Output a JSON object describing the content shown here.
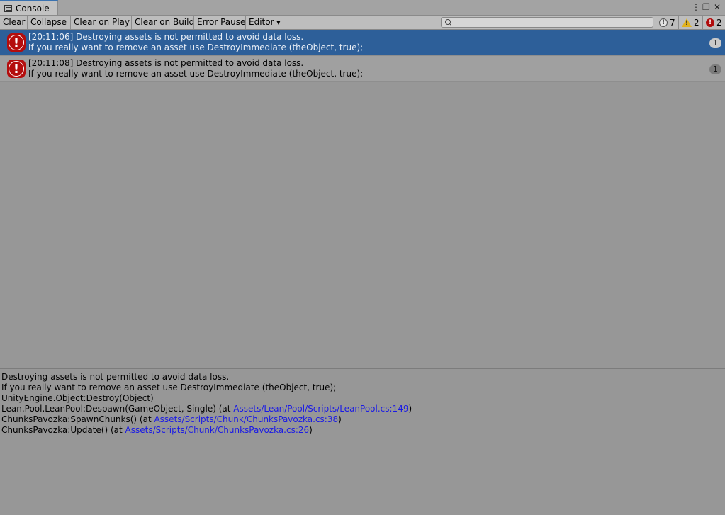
{
  "tab": {
    "title": "Console"
  },
  "window": {
    "menu_glyph": "⋮",
    "restore_glyph": "❐",
    "close_glyph": "✕"
  },
  "toolbar": {
    "clear": "Clear",
    "collapse": "Collapse",
    "clear_on_play": "Clear on Play",
    "clear_on_build": "Clear on Build",
    "error_pause": "Error Pause",
    "editor": "Editor",
    "editor_caret": "▾",
    "search_placeholder": ""
  },
  "counters": {
    "info": "7",
    "warnings": "2",
    "errors": "2"
  },
  "entries": [
    {
      "line1": "[20:11:06] Destroying assets is not permitted to avoid data loss.",
      "line2": "If you really want to remove an asset use DestroyImmediate (theObject, true);",
      "count": "1",
      "selected": true
    },
    {
      "line1": "[20:11:08] Destroying assets is not permitted to avoid data loss.",
      "line2": "If you really want to remove an asset use DestroyImmediate (theObject, true);",
      "count": "1",
      "selected": false
    }
  ],
  "detail": {
    "line1": "Destroying assets is not permitted to avoid data loss.",
    "line2": "If you really want to remove an asset use DestroyImmediate (theObject, true);",
    "line3": "UnityEngine.Object:Destroy(Object)",
    "line4_prefix": "Lean.Pool.LeanPool:Despawn(GameObject, Single) (at ",
    "line4_link": "Assets/Lean/Pool/Scripts/LeanPool.cs:149",
    "line5_prefix": "ChunksPavozka:SpawnChunks() (at ",
    "line5_link": "Assets/Scripts/Chunk/ChunksPavozka.cs:38",
    "line6_prefix": "ChunksPavozka:Update() (at ",
    "line6_link": "Assets/Scripts/Chunk/ChunksPavozka.cs:26",
    "close_paren": ")"
  },
  "colors": {
    "selected_row": "#2d5f99",
    "link": "#1a1ae6",
    "error_red": "#b40d0d",
    "warn_yellow": "#e2b21c"
  }
}
